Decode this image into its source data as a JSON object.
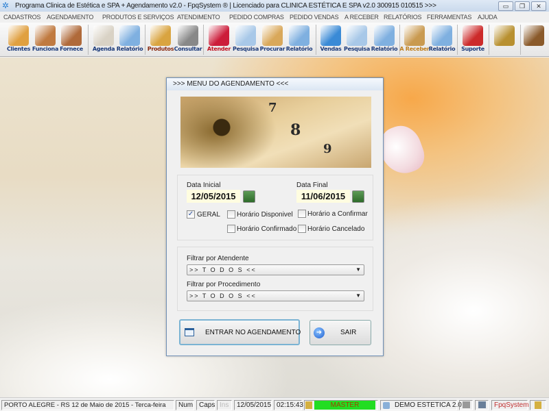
{
  "window": {
    "title": "Programa Clinica de Estética e SPA + Agendamento v2.0 - FpqSystem ® | Licenciado para  CLINICA ESTÉTICA E SPA v2.0 300915 010515 >>>",
    "minimize": "▭",
    "restore": "❐",
    "close": "✕"
  },
  "menu": [
    "CADASTROS",
    "AGENDAMENTO",
    "PRODUTOS E SERVIÇOS",
    "ATENDIMENTO",
    "PEDIDO COMPRAS",
    "PEDIDO VENDAS",
    "A RECEBER",
    "RELATÓRIOS",
    "FERRAMENTAS",
    "AJUDA"
  ],
  "toolbar": [
    {
      "label": "Clientes",
      "icon": "clients-icon",
      "color": "#e0a040"
    },
    {
      "label": "Funciona",
      "icon": "employees-icon",
      "color": "#c07a40"
    },
    {
      "label": "Fornece",
      "icon": "supplier-icon",
      "color": "#b06a3a"
    },
    {
      "label": "Agenda",
      "icon": "calendar-clock-icon",
      "color": "#d9d2c5"
    },
    {
      "label": "Relatório",
      "icon": "report-icon",
      "color": "#7fb0e0"
    },
    {
      "label": "Produtos",
      "icon": "boxes-icon",
      "color": "#d9a440"
    },
    {
      "label": "Consultar",
      "icon": "barcode-icon",
      "color": "#888888"
    },
    {
      "label": "Atender",
      "icon": "attend-icon",
      "color": "#cc1d3a"
    },
    {
      "label": "Pesquisa",
      "icon": "search-doc-icon",
      "color": "#a8c8e8"
    },
    {
      "label": "Procurar",
      "icon": "file-drawer-icon",
      "color": "#d9a85a"
    },
    {
      "label": "Relatório",
      "icon": "report-icon",
      "color": "#7fb0e0"
    },
    {
      "label": "Vendas",
      "icon": "monitor-icon",
      "color": "#3a8ad6"
    },
    {
      "label": "Pesquisa",
      "icon": "search-doc-icon",
      "color": "#a8c8e8"
    },
    {
      "label": "Relatório",
      "icon": "report-icon",
      "color": "#7fb0e0"
    },
    {
      "label": "A Receber",
      "icon": "money-bag-icon",
      "color": "#c99a50"
    },
    {
      "label": "Relatório",
      "icon": "report-icon",
      "color": "#7fb0e0"
    },
    {
      "label": "Suporte",
      "icon": "support-icon",
      "color": "#cc2a2a"
    },
    {
      "label": "",
      "icon": "coin-icon",
      "color": "#b89030"
    },
    {
      "label": "",
      "icon": "exit-icon",
      "color": "#8a5a2a"
    }
  ],
  "dialog": {
    "title": ">>>  MENU DO AGENDAMENTO  <<<",
    "calendar_numbers": [
      "7",
      "8",
      "9"
    ],
    "data_inicial_label": "Data Inicial",
    "data_inicial": "12/05/2015",
    "data_final_label": "Data Final",
    "data_final": "11/06/2015",
    "checkboxes": [
      {
        "label": "GERAL",
        "checked": true
      },
      {
        "label": "Horário  Disponivel",
        "checked": false
      },
      {
        "label": "Horário Confirmado",
        "checked": false
      },
      {
        "label": "Horário a Confirmar",
        "checked": false
      },
      {
        "label": "Horário Cancelado",
        "checked": false
      }
    ],
    "check_mark": "✓",
    "atendente_label": "Filtrar por Atendente",
    "atendente_value": ">> T O D O S <<",
    "procedimento_label": "Filtrar por Procedimento",
    "procedimento_value": ">> T O D O S <<",
    "dropdown_arrow": "▼",
    "enter_button": "ENTRAR NO AGENDAMENTO",
    "exit_button": "SAIR",
    "exit_arrow": "➜"
  },
  "status": {
    "location": "PORTO ALEGRE - RS 12 de Maio de 2015 - Terca-feira",
    "num": "Num",
    "caps": "Caps",
    "ins": "Ins",
    "date": "12/05/2015",
    "time": "02:15:43",
    "user": "MASTER",
    "company": "DEMO ESTETICA 2.0",
    "brand": "FpqSystem"
  }
}
